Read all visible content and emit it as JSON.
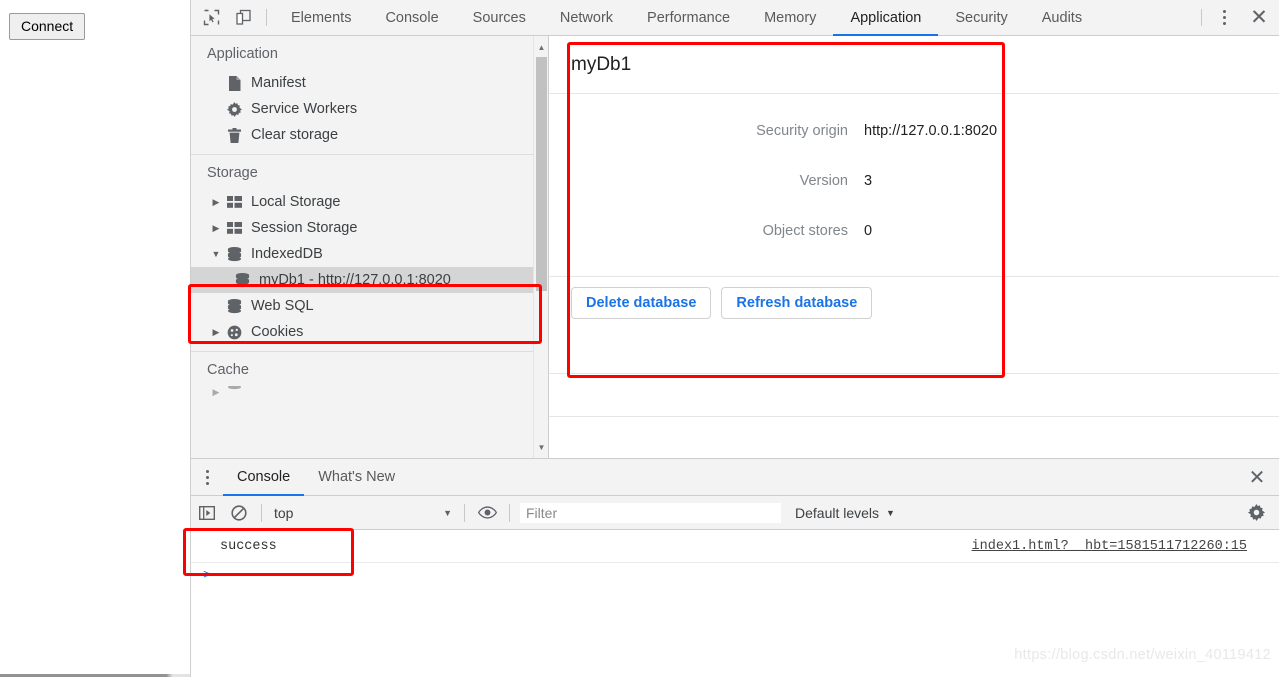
{
  "page": {
    "connect_button": "Connect"
  },
  "devtools": {
    "toolbar": {
      "inspect_icon": "inspect-element-icon",
      "device_icon": "device-toolbar-icon",
      "more_icon": "more-options-icon",
      "close_icon": "close-icon",
      "tabs": [
        {
          "label": "Elements",
          "active": false
        },
        {
          "label": "Console",
          "active": false
        },
        {
          "label": "Sources",
          "active": false
        },
        {
          "label": "Network",
          "active": false
        },
        {
          "label": "Performance",
          "active": false
        },
        {
          "label": "Memory",
          "active": false
        },
        {
          "label": "Application",
          "active": true
        },
        {
          "label": "Security",
          "active": false
        },
        {
          "label": "Audits",
          "active": false
        }
      ]
    },
    "sidebar": {
      "sections": [
        {
          "title": "Application",
          "items": [
            {
              "label": "Manifest",
              "icon": "document-icon",
              "arrow": "none",
              "indent": 1
            },
            {
              "label": "Service Workers",
              "icon": "gear-icon",
              "arrow": "none",
              "indent": 1
            },
            {
              "label": "Clear storage",
              "icon": "trash-icon",
              "arrow": "none",
              "indent": 1
            }
          ]
        },
        {
          "title": "Storage",
          "items": [
            {
              "label": "Local Storage",
              "icon": "table-icon",
              "arrow": "collapsed",
              "indent": 1
            },
            {
              "label": "Session Storage",
              "icon": "table-icon",
              "arrow": "collapsed",
              "indent": 1
            },
            {
              "label": "IndexedDB",
              "icon": "database-icon",
              "arrow": "expanded",
              "indent": 1
            },
            {
              "label": "myDb1 - http://127.0.0.1:8020",
              "icon": "database-icon",
              "arrow": "none",
              "indent": 2,
              "selected": true
            },
            {
              "label": "Web SQL",
              "icon": "database-icon",
              "arrow": "none",
              "indent": 1
            },
            {
              "label": "Cookies",
              "icon": "cookie-icon",
              "arrow": "collapsed",
              "indent": 1
            }
          ]
        },
        {
          "title": "Cache",
          "items": []
        }
      ]
    },
    "database_panel": {
      "title": "myDb1",
      "fields": [
        {
          "key": "Security origin",
          "value": "http://127.0.0.1:8020"
        },
        {
          "key": "Version",
          "value": "3"
        },
        {
          "key": "Object stores",
          "value": "0"
        }
      ],
      "delete_button": "Delete database",
      "refresh_button": "Refresh database"
    },
    "drawer": {
      "more_icon": "more-options-icon",
      "close_icon": "close-icon",
      "tabs": [
        {
          "label": "Console",
          "active": true
        },
        {
          "label": "What's New",
          "active": false
        }
      ],
      "console_toolbar": {
        "sidebar_toggle_icon": "console-sidebar-icon",
        "clear_icon": "clear-console-icon",
        "context": "top",
        "context_caret": "chevron-down-icon",
        "eye_icon": "live-expression-icon",
        "filter_placeholder": "Filter",
        "filter_value": "",
        "levels_label": "Default levels",
        "levels_caret": "chevron-down-icon",
        "settings_icon": "gear-icon"
      },
      "console_messages": [
        {
          "text": "success",
          "source": "index1.html?__hbt=1581511712260:15"
        }
      ],
      "prompt_caret": ">"
    }
  },
  "watermark": "https://blog.csdn.net/weixin_40119412",
  "colors": {
    "accent": "#1a73e8",
    "annotation": "#ff0000",
    "toolbar_bg": "#f3f3f3",
    "selection": "#d5d5d5"
  }
}
